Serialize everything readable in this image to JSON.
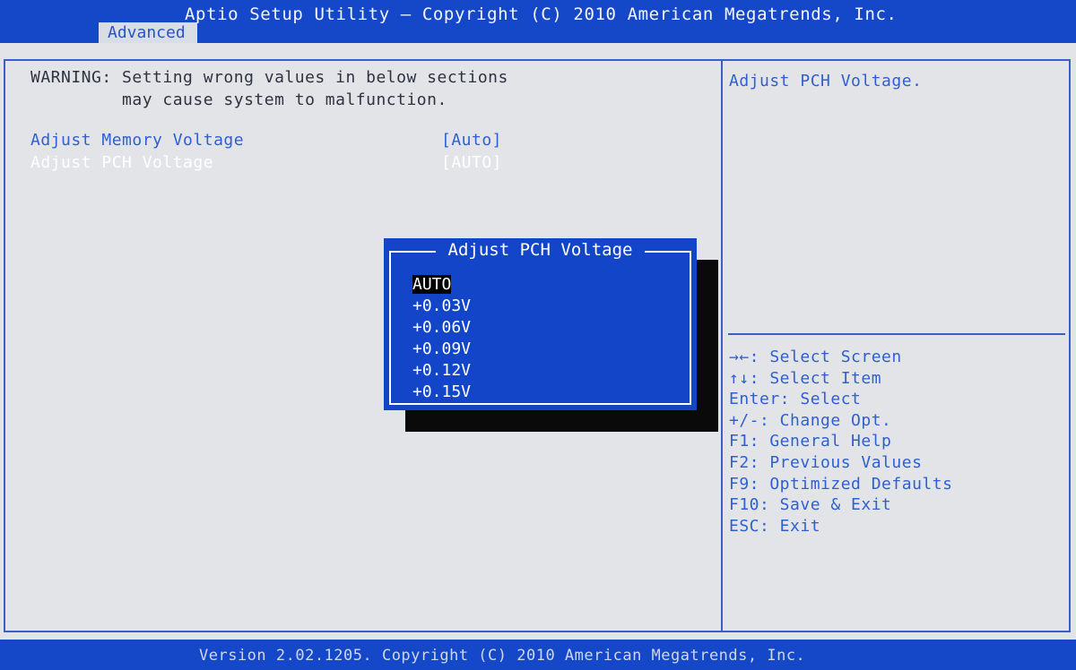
{
  "header": {
    "title": "Aptio Setup Utility – Copyright (C) 2010 American Megatrends, Inc.",
    "active_tab": "Advanced"
  },
  "main": {
    "warning": "WARNING: Setting wrong values in below sections\n         may cause system to malfunction.",
    "items": [
      {
        "label": "Adjust Memory Voltage",
        "value": "[Auto]"
      },
      {
        "label": "Adjust PCH Voltage",
        "value": "[AUTO]"
      }
    ]
  },
  "help": {
    "description": "Adjust PCH Voltage.",
    "keys": [
      "→←: Select Screen",
      "↑↓: Select Item",
      "Enter: Select",
      "+/-: Change Opt.",
      "F1: General Help",
      "F2: Previous Values",
      "F9: Optimized Defaults",
      "F10: Save & Exit",
      "ESC: Exit"
    ]
  },
  "popup": {
    "title": "Adjust PCH Voltage",
    "options": [
      "AUTO",
      "+0.03V",
      "+0.06V",
      "+0.09V",
      "+0.12V",
      "+0.15V"
    ],
    "selected": "AUTO"
  },
  "footer": {
    "text": "Version 2.02.1205. Copyright (C) 2010 American Megatrends, Inc."
  }
}
